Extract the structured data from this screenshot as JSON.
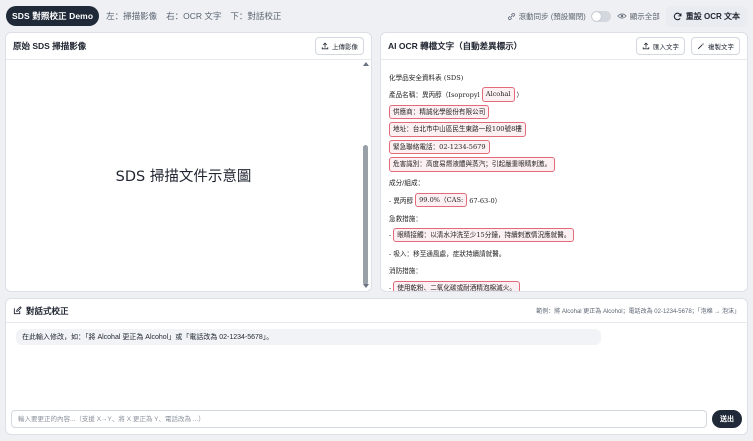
{
  "header": {
    "brand": "SDS 對照校正 Demo",
    "hints": [
      "左：掃描影像",
      "右：OCR 文字",
      "下：對話校正"
    ],
    "sync_label": "滾動同步 (預設關閉)",
    "show_all_label": "顯示全部",
    "reset_label": "重設 OCR 文本"
  },
  "left": {
    "title": "原始 SDS 掃描影像",
    "upload_label": "上傳影像",
    "placeholder": "SDS 掃描文件示意圖"
  },
  "right": {
    "title": "AI OCR 轉檔文字（自動差異標示）",
    "import_label": "匯入文字",
    "copy_label": "複製文字",
    "lines": [
      [
        {
          "t": "化學品安全資料表 (SDS)",
          "d": false
        }
      ],
      [
        {
          "t": "產品名稱：異丙醇（Isopropyl",
          "d": false
        },
        {
          "t": "Alcohal",
          "d": true
        },
        {
          "t": "）",
          "d": false
        }
      ],
      [
        {
          "t": "供應商：精誠化學股份有限公司",
          "d": true
        }
      ],
      [
        {
          "t": "地址：台北市中山區民生東路一段100號8樓",
          "d": true
        }
      ],
      [
        {
          "t": "緊急聯絡電話：02-1234-5679",
          "d": true
        }
      ],
      [
        {
          "t": "危害識別：高度易燃液體與蒸汽；引起嚴重眼睛刺激。",
          "d": true
        }
      ],
      [
        {
          "t": "成分/組成：",
          "d": false
        }
      ],
      [
        {
          "t": "- 異丙醇",
          "d": false
        },
        {
          "t": "99.0%（CAS:",
          "d": true
        },
        {
          "t": "67-63-0）",
          "d": false
        }
      ],
      [
        {
          "t": "急救措施：",
          "d": false
        }
      ],
      [
        {
          "t": "-",
          "d": false
        },
        {
          "t": "眼睛接觸：以清水沖洗至少15分鐘，持續刺激情況應就醫。",
          "d": true
        }
      ],
      [
        {
          "t": "- 吸入：移至通風處，症狀持續請就醫。",
          "d": false
        }
      ],
      [
        {
          "t": "消防措施：",
          "d": false
        }
      ],
      [
        {
          "t": "-",
          "d": false
        },
        {
          "t": "使用乾粉、二氧化碳或耐酒精泡棉滅火。",
          "d": true
        }
      ]
    ]
  },
  "chat": {
    "title": "對話式校正",
    "examples": "範例：將 Alcohal 更正為 Alcohol；電話改為 02-1234-5678；「泡棉 → 泡沫」",
    "bubble": "在此輸入修改，如：「將 Alcohal 更正為 Alcohol」或「電話改為 02-1234-5678」。",
    "input_placeholder": "輸入要更正的內容...（支援 X→Y、將 X 更正為 Y、電話改為 ...）",
    "send_label": "送出"
  }
}
